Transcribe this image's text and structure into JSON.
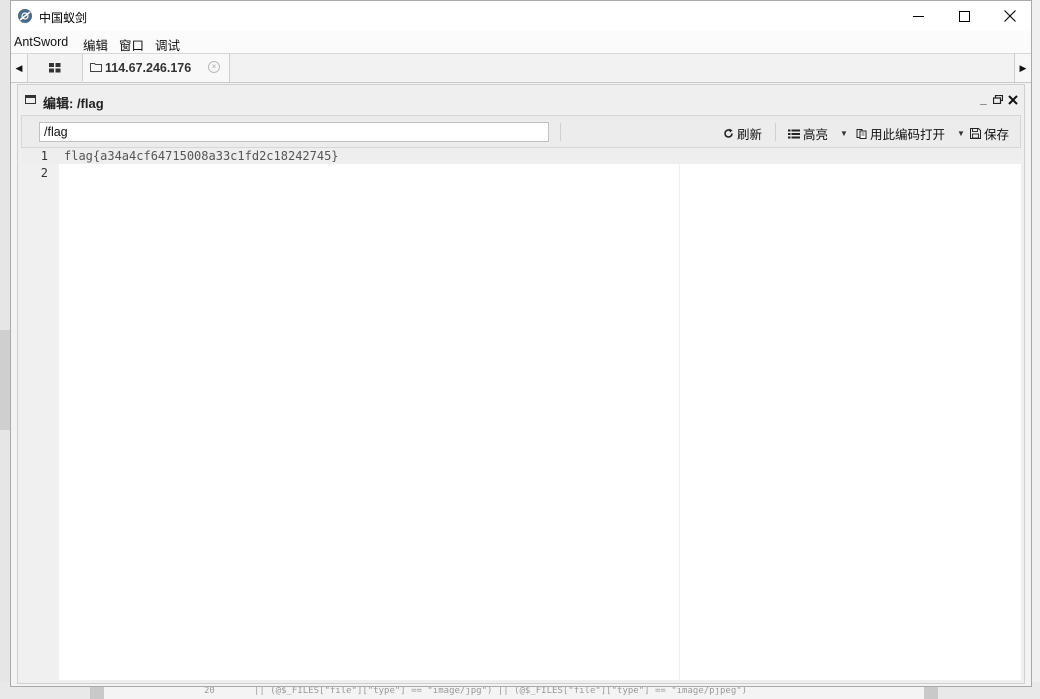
{
  "window": {
    "title": "中国蚁剑"
  },
  "menu": {
    "items": [
      "AntSword",
      "编辑",
      "窗口",
      "调试"
    ]
  },
  "tabs": {
    "active_label": "114.67.246.176",
    "close_glyph": "×"
  },
  "panel": {
    "title": "编辑: /flag"
  },
  "toolbar": {
    "path_value": "/flag",
    "refresh_label": "刷新",
    "highlight_label": "高亮",
    "open_with_encoding_label": "用此编码打开",
    "save_label": "保存"
  },
  "editor": {
    "line_numbers": [
      "1",
      "2"
    ],
    "lines": [
      "flag{a34a4cf64715008a33c1fd2c18242745}",
      ""
    ]
  },
  "background_code": {
    "line_number": "20",
    "text": "|| (@$_FILES[\"file\"][\"type\"] == \"image/jpg\") || (@$_FILES[\"file\"][\"type\"] == \"image/pjpeg\")"
  },
  "colors": {
    "window_bg": "#f3f3f3",
    "active_line": "#eeeeee",
    "gutter": "#f0f0f0"
  },
  "icons": [
    "app-logo-icon",
    "minimize-icon",
    "maximize-icon",
    "close-icon",
    "grid-icon",
    "folder-icon",
    "refresh-icon",
    "list-icon",
    "open-file-icon",
    "save-icon"
  ]
}
